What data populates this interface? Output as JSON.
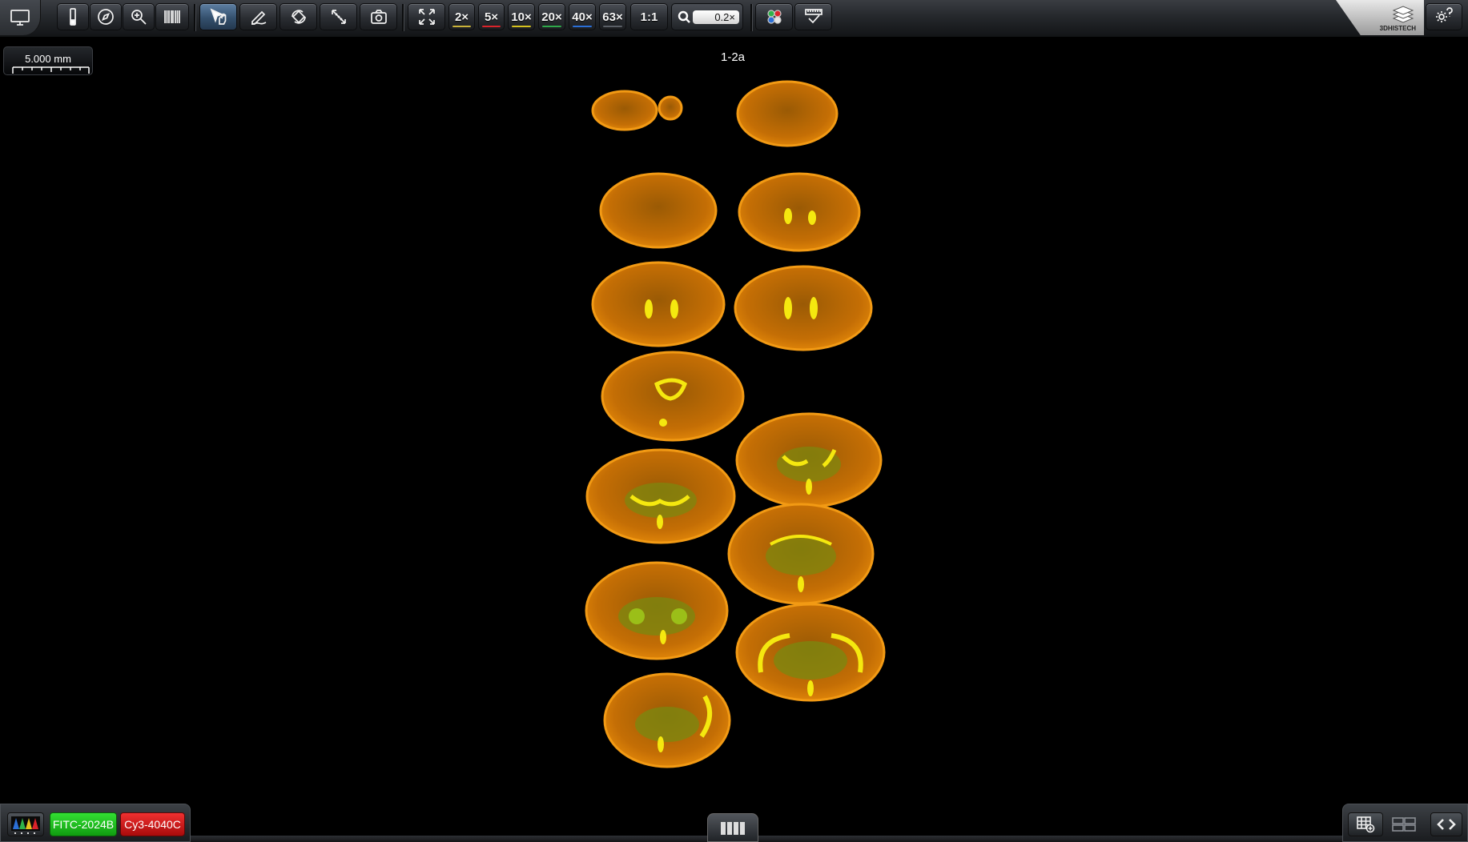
{
  "toolbar": {
    "monitor_icon": "monitor-icon",
    "tools": [
      "slide-icon",
      "navigator-icon",
      "zoom-icon",
      "barcode-icon",
      "pointer-hand-icon",
      "annotate-icon",
      "rotate-icon",
      "measure-icon",
      "snapshot-icon",
      "fit-screen-icon"
    ],
    "magnifications": [
      {
        "label": "2×",
        "color": "#c9b23a"
      },
      {
        "label": "5×",
        "color": "#d9242b"
      },
      {
        "label": "10×",
        "color": "#d6c21f"
      },
      {
        "label": "20×",
        "color": "#2fa84a"
      },
      {
        "label": "40×",
        "color": "#2b6fd6"
      },
      {
        "label": "63×",
        "color": "#5a5f66"
      }
    ],
    "one_to_one": "1:1",
    "zoom_value": "0.2×",
    "right_tools": [
      "channels-icon",
      "ruler-check-icon"
    ],
    "brand": "3DHISTECH",
    "settings_icon": "gear-help-icon"
  },
  "scalebar": {
    "label": "5.000 mm"
  },
  "slide": {
    "title": "1-2a"
  },
  "channels": {
    "icon": "fluorescence-channels-icon",
    "items": [
      {
        "label": "FITC-2024B",
        "color": "#1ec41e"
      },
      {
        "label": "Cy3-4040C",
        "color": "#d91818"
      }
    ]
  },
  "bottom": {
    "handle_icon": "panel-handle-icon"
  }
}
